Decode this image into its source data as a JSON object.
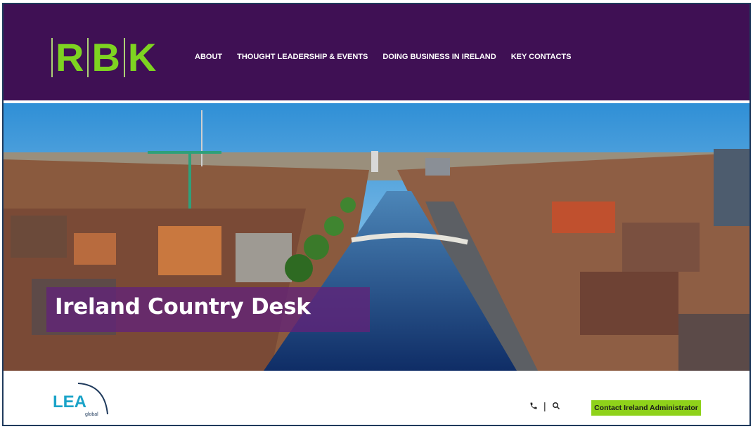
{
  "header": {
    "logo_letters": [
      "R",
      "B",
      "K"
    ],
    "nav": [
      {
        "label": "ABOUT"
      },
      {
        "label": "THOUGHT LEADERSHIP & EVENTS"
      },
      {
        "label": "DOING BUSINESS IN IRELAND"
      },
      {
        "label": "KEY CONTACTS"
      }
    ]
  },
  "hero": {
    "image": "aerial-dublin-river-liffey-photo",
    "caption": "Ireland Country Desk"
  },
  "footer": {
    "lea_logo_text": "LEA",
    "lea_logo_subtext": "global",
    "phone_icon": "phone-icon",
    "search_icon": "search-icon",
    "separator": "|",
    "contact_button": "Contact Ireland Administrator"
  },
  "colors": {
    "header_bg": "#3f1054",
    "logo_green": "#7ed321",
    "button_green": "#8fd21a",
    "caption_bg": "#622278",
    "frame_border": "#1f3a5c"
  }
}
